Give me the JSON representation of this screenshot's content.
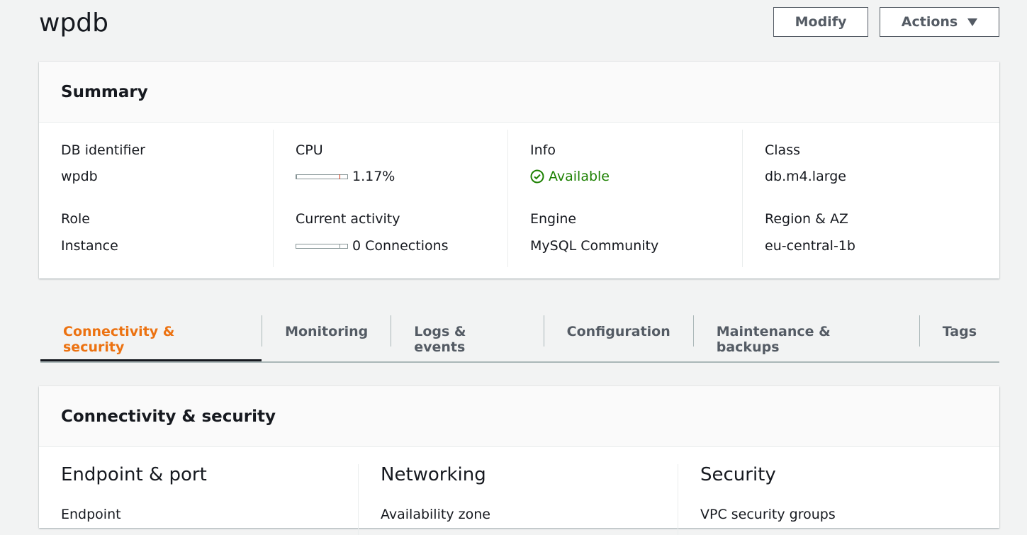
{
  "header": {
    "title": "wpdb",
    "modify_label": "Modify",
    "actions_label": "Actions"
  },
  "summary": {
    "title": "Summary",
    "cols": [
      {
        "label1": "DB identifier",
        "value1": "wpdb",
        "label2": "Role",
        "value2": "Instance"
      },
      {
        "label1": "CPU",
        "value1": "1.17%",
        "label2": "Current activity",
        "value2": "0 Connections"
      },
      {
        "label1": "Info",
        "value1": "Available",
        "label2": "Engine",
        "value2": "MySQL Community"
      },
      {
        "label1": "Class",
        "value1": "db.m4.large",
        "label2": "Region & AZ",
        "value2": "eu-central-1b"
      }
    ],
    "cpu_fraction": 0.0117,
    "connections_fraction": 0
  },
  "tabs": [
    {
      "label": "Connectivity & security",
      "active": true
    },
    {
      "label": "Monitoring"
    },
    {
      "label": "Logs & events"
    },
    {
      "label": "Configuration"
    },
    {
      "label": "Maintenance & backups"
    },
    {
      "label": "Tags"
    }
  ],
  "connectivity": {
    "title": "Connectivity & security",
    "sections": [
      {
        "heading": "Endpoint & port",
        "first_label": "Endpoint"
      },
      {
        "heading": "Networking",
        "first_label": "Availability zone"
      },
      {
        "heading": "Security",
        "first_label": "VPC security groups"
      }
    ]
  },
  "colors": {
    "accent": "#ec7211",
    "status_ok": "#1d8102"
  },
  "icons": {
    "status": "check-circle-icon",
    "dropdown": "caret-down-icon"
  }
}
